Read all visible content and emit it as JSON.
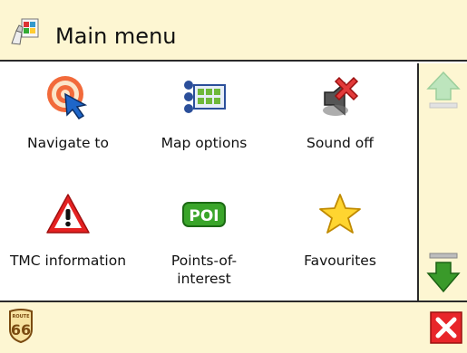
{
  "header": {
    "title": "Main menu",
    "icon": "main-menu-app-icon"
  },
  "menu": {
    "items": [
      {
        "label": "Navigate to",
        "icon": "target-cursor-icon"
      },
      {
        "label": "Map options",
        "icon": "map-options-icon"
      },
      {
        "label": "Sound off",
        "icon": "speaker-mute-icon"
      },
      {
        "label": "TMC information",
        "icon": "warning-triangle-icon"
      },
      {
        "label": "Points-of-",
        "label2": "interest",
        "icon": "poi-icon"
      },
      {
        "label": "Favourites",
        "icon": "star-icon"
      }
    ]
  },
  "scrollbar": {
    "up_icon": "arrow-up-icon",
    "up_enabled": false,
    "down_icon": "arrow-down-icon",
    "down_enabled": true
  },
  "footer": {
    "logo_icon": "route-66-logo",
    "logo_text_top": "ROUTE",
    "logo_text_main": "66",
    "close_icon": "close-icon"
  },
  "colors": {
    "panel_bg": "#fdf6d2",
    "border": "#2a2a2a",
    "close_red": "#e8262a",
    "arrow_green": "#3a9a2a",
    "arrow_disabled": "#bde5bd"
  }
}
